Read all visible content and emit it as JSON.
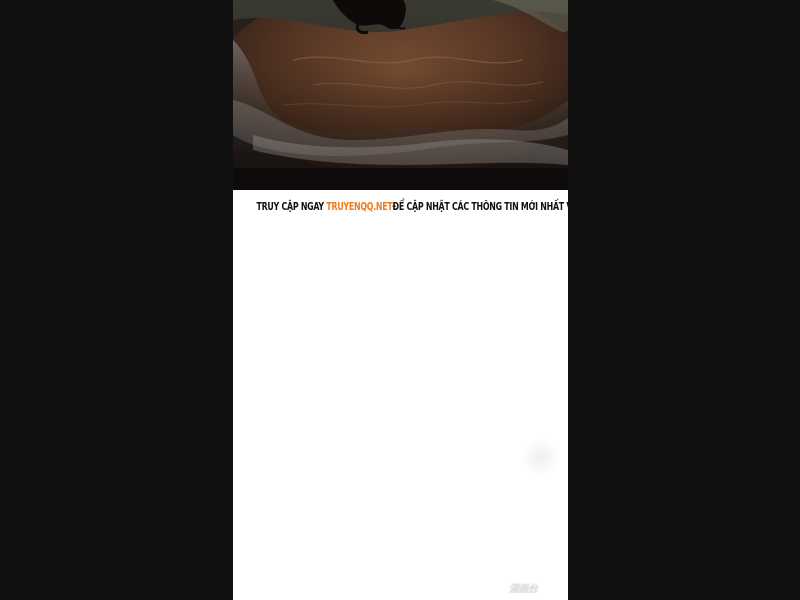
{
  "notice": {
    "prefix": "TRUY CẬP NGAY",
    "link": "TRUYENQQ.NET",
    "suffix": "ĐỂ CẬP NHẬT CÁC THÔNG TIN MỚI NHẤT VỀ TRUYỆN"
  },
  "watermark": {
    "text": "漫画台"
  },
  "colors": {
    "background": "#111111",
    "page": "#ffffff",
    "link": "#f07a1b",
    "panel": "#1a1512"
  }
}
